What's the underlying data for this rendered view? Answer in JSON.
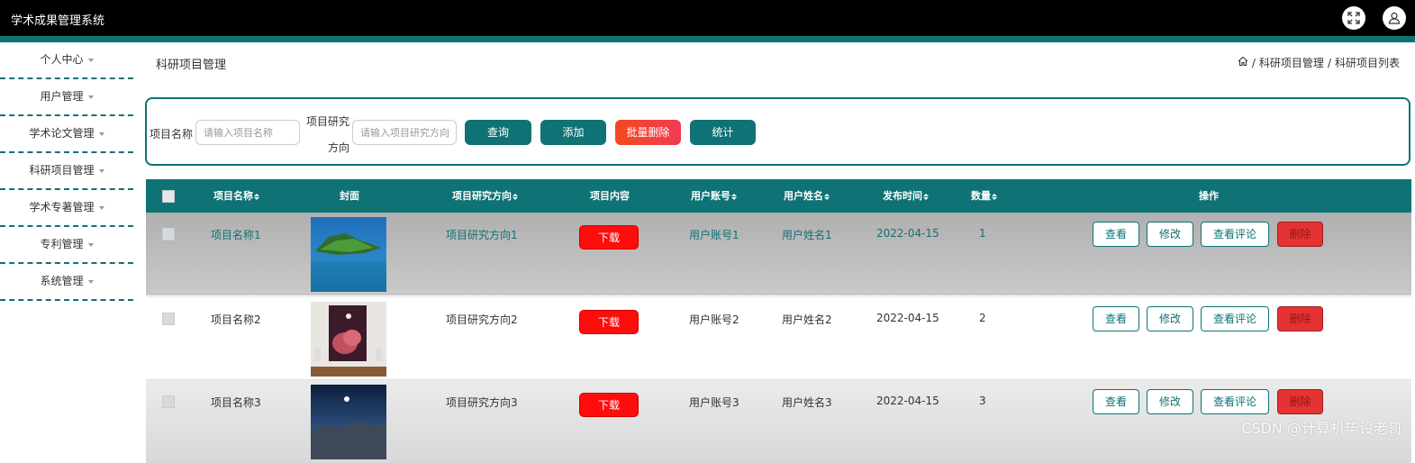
{
  "app": {
    "title": "学术成果管理系统"
  },
  "sidebar": {
    "items": [
      {
        "label": "个人中心"
      },
      {
        "label": "用户管理"
      },
      {
        "label": "学术论文管理"
      },
      {
        "label": "科研项目管理"
      },
      {
        "label": "学术专著管理"
      },
      {
        "label": "专利管理"
      },
      {
        "label": "系统管理"
      }
    ]
  },
  "page": {
    "title": "科研项目管理"
  },
  "breadcrumb": {
    "sep": "/",
    "level1": "科研项目管理",
    "level2": "科研项目列表"
  },
  "search": {
    "name_label": "项目名称",
    "name_placeholder": "请输入项目名称",
    "direction_label_line1": "项目研究",
    "direction_label_line2": "方向",
    "direction_placeholder": "请输入项目研究方向",
    "query_button": "查询",
    "add_button": "添加",
    "batch_delete_button": "批量删除",
    "stats_button": "统计"
  },
  "table": {
    "columns": {
      "name": "项目名称",
      "cover": "封面",
      "direction": "项目研究方向",
      "content": "项目内容",
      "account": "用户账号",
      "username": "用户姓名",
      "date": "发布时间",
      "qty": "数量",
      "actions": "操作"
    },
    "rows": [
      {
        "name": "项目名称1",
        "direction": "项目研究方向1",
        "download": "下载",
        "account": "用户账号1",
        "username": "用户姓名1",
        "date": "2022-04-15",
        "qty": "1"
      },
      {
        "name": "项目名称2",
        "direction": "项目研究方向2",
        "download": "下载",
        "account": "用户账号2",
        "username": "用户姓名2",
        "date": "2022-04-15",
        "qty": "2"
      },
      {
        "name": "项目名称3",
        "direction": "项目研究方向3",
        "download": "下载",
        "account": "用户账号3",
        "username": "用户姓名3",
        "date": "2022-04-15",
        "qty": "3"
      }
    ],
    "row_actions": {
      "view": "查看",
      "edit": "修改",
      "comments": "查看评论",
      "delete": "删除"
    }
  },
  "watermark": "CSDN @计算机毕设老哥",
  "colors": {
    "topbar": "#000000",
    "accent": "#0f7275",
    "danger": "#ff0c0c",
    "batch_delete": "#f4452b"
  },
  "icons": [
    "fullscreen-icon",
    "user-icon",
    "home-icon"
  ]
}
